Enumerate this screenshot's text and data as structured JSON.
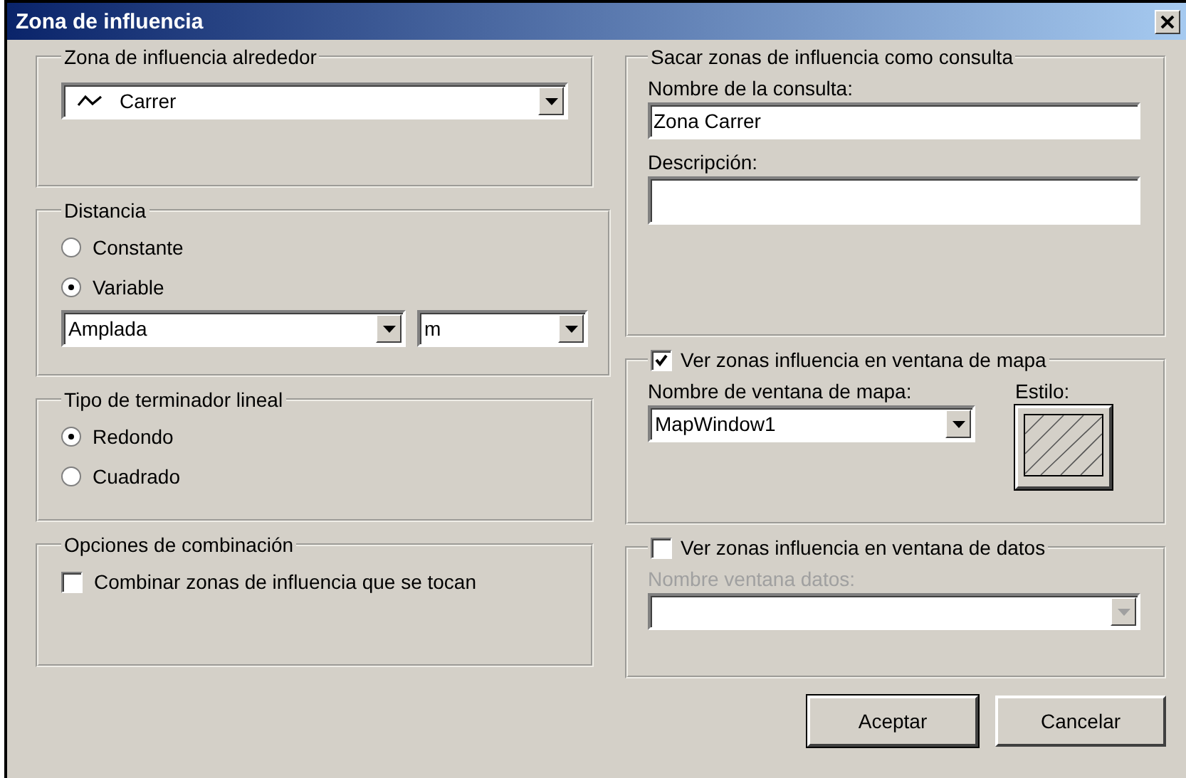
{
  "window": {
    "title": "Zona de influencia"
  },
  "buffer_around": {
    "label": "Zona de influencia alrededor",
    "value": "Carrer"
  },
  "distance": {
    "label": "Distancia",
    "options": [
      {
        "label": "Constante",
        "selected": false
      },
      {
        "label": "Variable",
        "selected": true
      }
    ],
    "field": "Amplada",
    "unit": "m"
  },
  "end_type": {
    "label": "Tipo de terminador lineal",
    "options": [
      {
        "label": "Redondo",
        "selected": true
      },
      {
        "label": "Cuadrado",
        "selected": false
      }
    ]
  },
  "combine": {
    "label": "Opciones de combinación",
    "checkbox": {
      "label": "Combinar zonas de influencia que se tocan",
      "checked": false
    }
  },
  "query": {
    "label": "Sacar zonas de influencia como consulta",
    "name_label": "Nombre de la consulta:",
    "name_value": "Zona Carrer",
    "description_label": "Descripción:"
  },
  "map_window": {
    "label": "Ver zonas influencia en ventana de mapa",
    "checked": true,
    "window_label": "Nombre de ventana de mapa:",
    "window_value": "MapWindow1",
    "style_label": "Estilo:"
  },
  "data_window": {
    "label": "Ver zonas influencia en ventana de datos",
    "checked": false,
    "window_label": "Nombre ventana datos:"
  },
  "buttons": [
    {
      "label": "Aceptar",
      "default": true
    },
    {
      "label": "Cancelar",
      "default": false
    }
  ]
}
